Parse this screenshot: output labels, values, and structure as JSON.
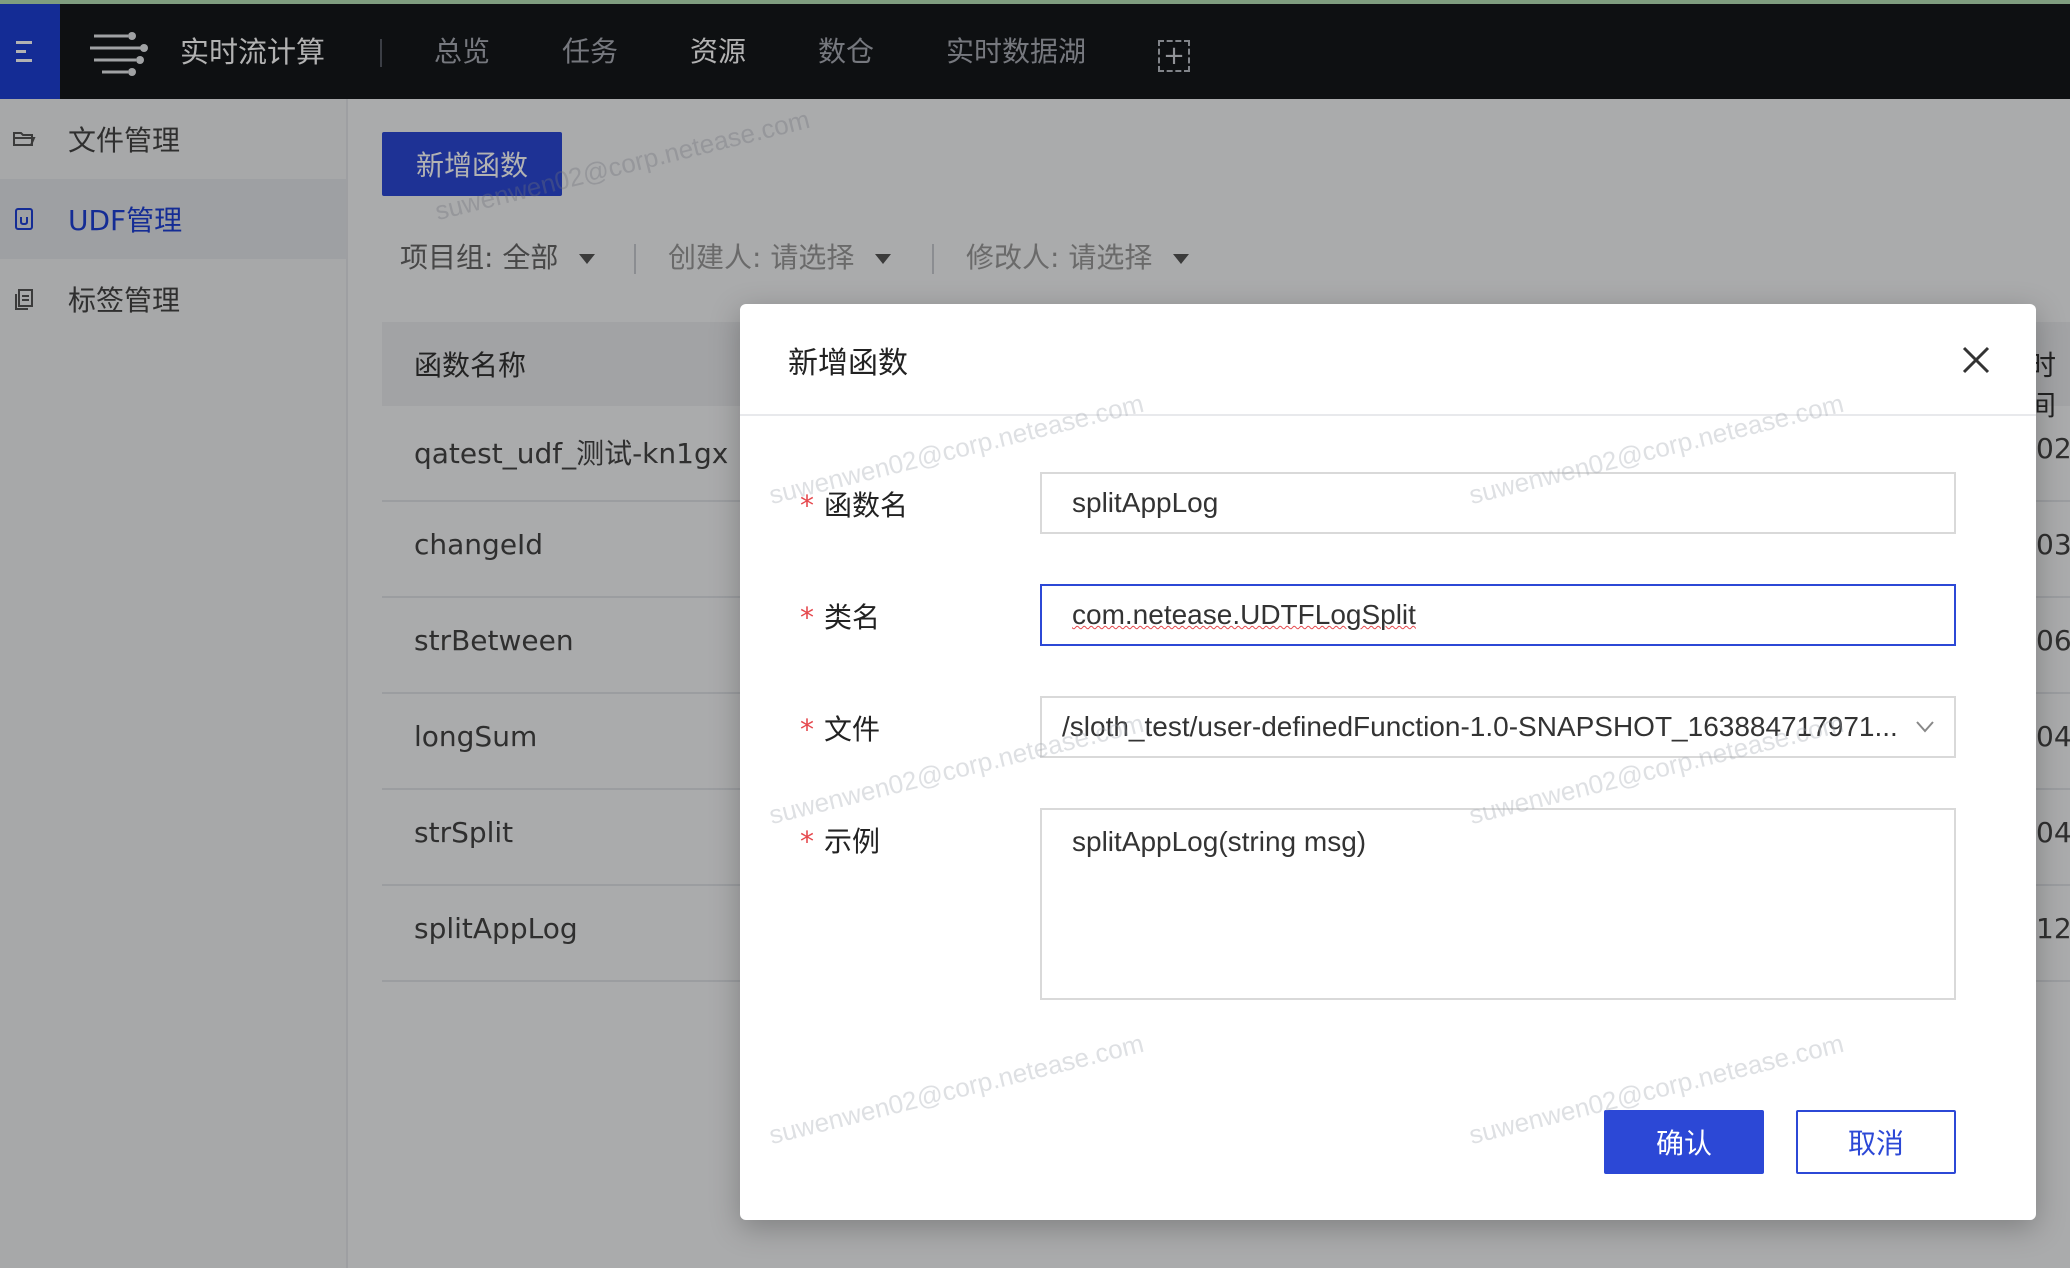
{
  "topbar": {
    "brand": "实时流计算",
    "nav": [
      {
        "label": "总览",
        "active": false
      },
      {
        "label": "任务",
        "active": false
      },
      {
        "label": "资源",
        "active": true
      },
      {
        "label": "数仓",
        "active": false
      },
      {
        "label": "实时数据湖",
        "active": false
      }
    ],
    "add_icon": "plus-square-icon"
  },
  "sidebar": {
    "items": [
      {
        "label": "文件管理",
        "icon": "folder-icon",
        "active": false
      },
      {
        "label": "UDF管理",
        "icon": "file-function-icon",
        "active": true
      },
      {
        "label": "标签管理",
        "icon": "tag-copy-icon",
        "active": false
      }
    ]
  },
  "main": {
    "add_button": "新增函数",
    "filters": {
      "project": {
        "label": "项目组:",
        "value": "全部"
      },
      "creator": {
        "label": "创建人:",
        "value": "请选择"
      },
      "modifier": {
        "label": "修改人:",
        "value": "请选择"
      }
    },
    "table": {
      "header_name": "函数名称",
      "header_right_fragment": "时间",
      "rows": [
        {
          "name": "qatest_udf_测试-kn1gx",
          "right": "02"
        },
        {
          "name": "changeId",
          "right": "03"
        },
        {
          "name": "strBetween",
          "right": "06"
        },
        {
          "name": "longSum",
          "right": "04"
        },
        {
          "name": "strSplit",
          "right": "04"
        },
        {
          "name": "splitAppLog",
          "right": "12"
        }
      ]
    }
  },
  "modal": {
    "title": "新增函数",
    "fields": {
      "function_name": {
        "label": "函数名",
        "value": "splitAppLog"
      },
      "class_name": {
        "label": "类名",
        "value": "com.netease.UDTFLogSplit"
      },
      "file": {
        "label": "文件",
        "value": "/sloth_test/user-definedFunction-1.0-SNAPSHOT_163884717971..."
      },
      "example": {
        "label": "示例",
        "value": "splitAppLog(string msg)"
      }
    },
    "confirm": "确认",
    "cancel": "取消"
  },
  "watermark": "suwenwen02@corp.netease.com",
  "colors": {
    "primary": "#2c48d6",
    "topbar_bg": "#15171b",
    "required": "#e5484d"
  }
}
